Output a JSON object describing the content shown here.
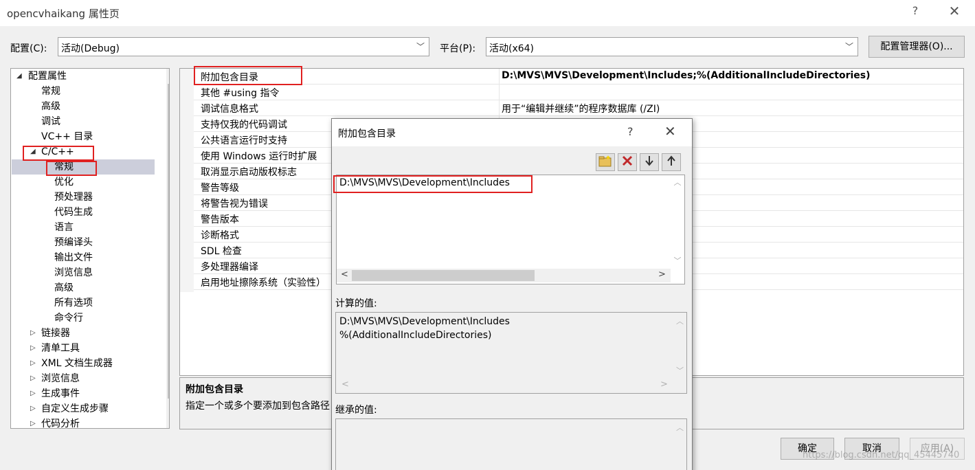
{
  "window": {
    "title": "opencvhaikang 属性页",
    "help": "?",
    "close": "✕"
  },
  "config": {
    "config_label": "配置(C):",
    "config_value": "活动(Debug)",
    "platform_label": "平台(P):",
    "platform_value": "活动(x64)",
    "manager_button": "配置管理器(O)..."
  },
  "tree": {
    "root": "配置属性",
    "general": [
      "常规",
      "高级",
      "调试",
      "VC++ 目录"
    ],
    "cpp": "C/C++",
    "cpp_children": [
      "常规",
      "优化",
      "预处理器",
      "代码生成",
      "语言",
      "预编译头",
      "输出文件",
      "浏览信息",
      "高级",
      "所有选项",
      "命令行"
    ],
    "collapsed": [
      "链接器",
      "清单工具",
      "XML 文档生成器",
      "浏览信息",
      "生成事件",
      "自定义生成步骤",
      "代码分析"
    ]
  },
  "grid": {
    "rows": [
      {
        "name": "附加包含目录",
        "value": "D:\\MVS\\MVS\\Development\\Includes;%(AdditionalIncludeDirectories)"
      },
      {
        "name": "其他 #using 指令",
        "value": ""
      },
      {
        "name": "调试信息格式",
        "value": "用于“编辑并继续”的程序数据库 (/ZI)"
      },
      {
        "name": "支持仅我的代码调试",
        "value": ""
      },
      {
        "name": "公共语言运行时支持",
        "value": ""
      },
      {
        "name": "使用 Windows 运行时扩展",
        "value": ""
      },
      {
        "name": "取消显示启动版权标志",
        "value": ""
      },
      {
        "name": "警告等级",
        "value": ""
      },
      {
        "name": "将警告视为错误",
        "value": ""
      },
      {
        "name": "警告版本",
        "value": ""
      },
      {
        "name": "诊断格式",
        "value": ""
      },
      {
        "name": "SDL 检查",
        "value": ""
      },
      {
        "name": "多处理器编译",
        "value": ""
      },
      {
        "name": "启用地址擦除系统（实验性）",
        "value": ""
      }
    ]
  },
  "description": {
    "title": "附加包含目录",
    "text": "指定一个或多个要添加到包含路径"
  },
  "dialog": {
    "title": "附加包含目录",
    "help": "?",
    "close": "✕",
    "toolbar": {
      "new_line_icon": "folder-new-icon",
      "delete_icon": "delete-icon",
      "down_icon": "move-down-icon",
      "up_icon": "move-up-icon"
    },
    "entry": "D:\\MVS\\MVS\\Development\\Includes",
    "computed_label": "计算的值:",
    "computed_lines": [
      "D:\\MVS\\MVS\\Development\\Includes",
      "%(AdditionalIncludeDirectories)"
    ],
    "inherited_label": "继承的值:"
  },
  "buttons": {
    "ok": "确定",
    "cancel": "取消",
    "apply": "应用(A)"
  },
  "watermark": "https://blog.csdn.net/qq_45445740",
  "colors": {
    "highlight_box": "#e02020",
    "selection": "#cccedb"
  }
}
